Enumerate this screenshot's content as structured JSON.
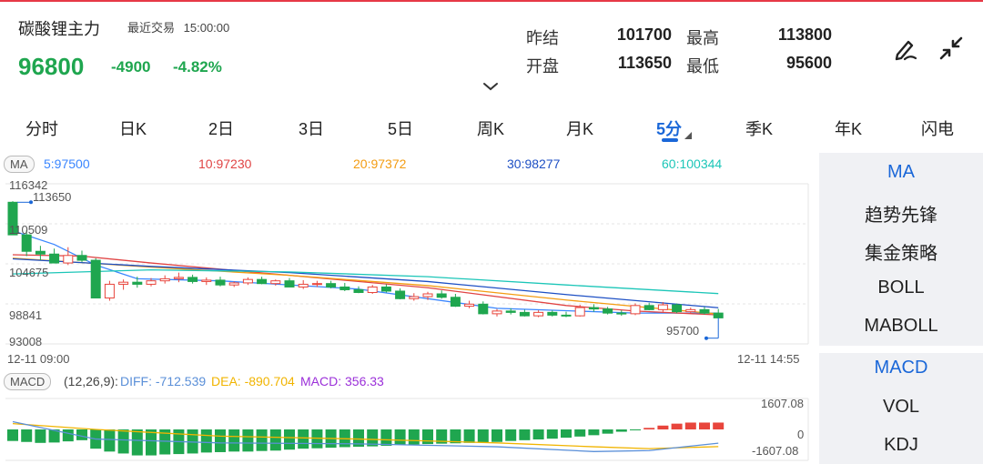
{
  "header": {
    "title": "碳酸锂主力",
    "trade_label": "最近交易",
    "trade_time": "15:00:00",
    "price": "96800",
    "change": "-4900",
    "change_pct": "-4.82%"
  },
  "quote": {
    "prev_settle_label": "昨结",
    "prev_settle": "101700",
    "high_label": "最高",
    "high": "113800",
    "open_label": "开盘",
    "open": "113650",
    "low_label": "最低",
    "low": "95600"
  },
  "tabs": [
    "分时",
    "日K",
    "2日",
    "3日",
    "5日",
    "周K",
    "月K",
    "5分",
    "季K",
    "年K",
    "闪电"
  ],
  "active_tab": "5分",
  "ma_legend": {
    "tag": "MA",
    "ma5": "5:97500",
    "ma10": "10:97230",
    "ma20": "20:97372",
    "ma30": "30:98277",
    "ma60": "60:100344"
  },
  "price_axis": {
    "labels": [
      "116342",
      "110509",
      "104675",
      "98841",
      "93008"
    ],
    "high_mark": "113650",
    "low_mark": "95700"
  },
  "time_axis": {
    "start": "12-11 09:00",
    "end": "12-11 14:55"
  },
  "macd_legend": {
    "tag": "MACD",
    "params": "(12,26,9):",
    "diff": "DIFF: -712.539",
    "dea": "DEA: -890.704",
    "macd": "MACD: 356.33"
  },
  "macd_axis": {
    "top": "1607.08",
    "zero": "0",
    "bottom": "-1607.08"
  },
  "side_menu": {
    "main": [
      "MA",
      "趋势先锋",
      "集金策略",
      "BOLL",
      "MABOLL"
    ],
    "sub": [
      "MACD",
      "VOL",
      "KDJ"
    ]
  },
  "colors": {
    "up": "#e8453c",
    "down": "#1fa64f",
    "accent": "#1a67d8",
    "ma5": "#3a86ff",
    "ma10": "#e04444",
    "ma20": "#f39c12",
    "ma30": "#1d4fc4",
    "ma60": "#1cc6b8",
    "dea": "#f1b400",
    "diff": "#5a8fd8",
    "macd_text": "#9b30d9"
  },
  "chart_data": {
    "type": "candlestick",
    "ylim": [
      93008,
      116342
    ],
    "candles": [
      [
        113650,
        113800,
        108900,
        108900
      ],
      [
        108900,
        109600,
        105800,
        106500
      ],
      [
        106500,
        107300,
        105200,
        106100
      ],
      [
        106100,
        106900,
        104800,
        104800
      ],
      [
        104800,
        107100,
        104500,
        105900
      ],
      [
        105900,
        106600,
        104900,
        105200
      ],
      [
        105200,
        105500,
        99700,
        99700
      ],
      [
        99700,
        102200,
        99300,
        101700
      ],
      [
        101700,
        102400,
        100900,
        102000
      ],
      [
        102000,
        102800,
        101200,
        101700
      ],
      [
        101700,
        102600,
        101400,
        102200
      ],
      [
        102200,
        103000,
        101800,
        102500
      ],
      [
        102500,
        103400,
        102000,
        102700
      ],
      [
        102700,
        103100,
        101800,
        102100
      ],
      [
        102100,
        102700,
        101600,
        102300
      ],
      [
        102300,
        102800,
        101400,
        101600
      ],
      [
        101600,
        102100,
        101300,
        101900
      ],
      [
        101900,
        102700,
        101600,
        102400
      ],
      [
        102400,
        102800,
        101700,
        101800
      ],
      [
        101800,
        102400,
        101500,
        102200
      ],
      [
        102200,
        102600,
        101300,
        101300
      ],
      [
        101300,
        102300,
        101000,
        101700
      ],
      [
        101700,
        102200,
        101300,
        101800
      ],
      [
        101800,
        102200,
        101100,
        101300
      ],
      [
        101300,
        101900,
        100700,
        100900
      ],
      [
        100900,
        101400,
        100400,
        100500
      ],
      [
        100500,
        101600,
        100300,
        101300
      ],
      [
        101300,
        101700,
        100500,
        100700
      ],
      [
        100700,
        101100,
        99500,
        99600
      ],
      [
        99600,
        100400,
        99300,
        99900
      ],
      [
        99900,
        100600,
        99400,
        100300
      ],
      [
        100300,
        100800,
        99600,
        99800
      ],
      [
        99800,
        100300,
        98400,
        98500
      ],
      [
        98500,
        99300,
        98200,
        98800
      ],
      [
        98800,
        99200,
        97300,
        97400
      ],
      [
        97400,
        98100,
        97000,
        97800
      ],
      [
        97800,
        98200,
        97300,
        97600
      ],
      [
        97600,
        98000,
        97000,
        97100
      ],
      [
        97100,
        97900,
        96900,
        97600
      ],
      [
        97600,
        97900,
        97000,
        97200
      ],
      [
        97200,
        97700,
        96900,
        97100
      ],
      [
        97100,
        98700,
        97000,
        98300
      ],
      [
        98300,
        98800,
        97700,
        98100
      ],
      [
        98100,
        98400,
        97300,
        97500
      ],
      [
        97500,
        97900,
        97100,
        97400
      ],
      [
        97400,
        98900,
        97200,
        98600
      ],
      [
        98600,
        99000,
        97900,
        98000
      ],
      [
        98000,
        99100,
        97700,
        98700
      ],
      [
        98700,
        98900,
        97500,
        97700
      ],
      [
        97700,
        98300,
        97400,
        98000
      ],
      [
        98000,
        98400,
        97300,
        97500
      ],
      [
        97500,
        98100,
        96800,
        96800
      ]
    ],
    "ma": {
      "ma5": [
        [
          0,
          109500
        ],
        [
          3,
          107500
        ],
        [
          6,
          104500
        ],
        [
          9,
          102500
        ],
        [
          15,
          102200
        ],
        [
          25,
          101000
        ],
        [
          35,
          98200
        ],
        [
          45,
          97500
        ],
        [
          51,
          97500
        ]
      ],
      "ma10": [
        [
          0,
          106000
        ],
        [
          5,
          105800
        ],
        [
          10,
          104800
        ],
        [
          20,
          103000
        ],
        [
          30,
          101200
        ],
        [
          40,
          98600
        ],
        [
          45,
          97800
        ],
        [
          51,
          97230
        ]
      ],
      "ma20": [
        [
          0,
          105500
        ],
        [
          10,
          104200
        ],
        [
          20,
          103000
        ],
        [
          30,
          101500
        ],
        [
          40,
          99400
        ],
        [
          51,
          97372
        ]
      ],
      "ma30": [
        [
          0,
          105400
        ],
        [
          10,
          104300
        ],
        [
          20,
          103400
        ],
        [
          30,
          102100
        ],
        [
          40,
          100200
        ],
        [
          51,
          98277
        ]
      ],
      "ma60": [
        [
          0,
          103200
        ],
        [
          10,
          103800
        ],
        [
          20,
          103500
        ],
        [
          30,
          102800
        ],
        [
          40,
          101600
        ],
        [
          51,
          100344
        ]
      ]
    },
    "macd": {
      "ylim": [
        -1607.08,
        1607.08
      ],
      "hist": [
        -600,
        -650,
        -700,
        -680,
        -620,
        -560,
        -1000,
        -1150,
        -1250,
        -1350,
        -1350,
        -1300,
        -1280,
        -1250,
        -1200,
        -1180,
        -1150,
        -1150,
        -1120,
        -1100,
        -1050,
        -1000,
        -980,
        -950,
        -920,
        -900,
        -880,
        -850,
        -800,
        -780,
        -760,
        -740,
        -720,
        -700,
        -680,
        -650,
        -600,
        -560,
        -520,
        -480,
        -430,
        -370,
        -300,
        -220,
        -120,
        -20,
        80,
        200,
        300,
        356,
        356,
        356
      ],
      "diff": [
        [
          0,
          400
        ],
        [
          6,
          -500
        ],
        [
          15,
          -700
        ],
        [
          25,
          -750
        ],
        [
          35,
          -900
        ],
        [
          42,
          -1150
        ],
        [
          46,
          -1100
        ],
        [
          51,
          -713
        ]
      ],
      "dea": [
        [
          0,
          300
        ],
        [
          6,
          0
        ],
        [
          15,
          -350
        ],
        [
          25,
          -500
        ],
        [
          35,
          -700
        ],
        [
          42,
          -900
        ],
        [
          46,
          -1000
        ],
        [
          51,
          -891
        ]
      ]
    }
  }
}
